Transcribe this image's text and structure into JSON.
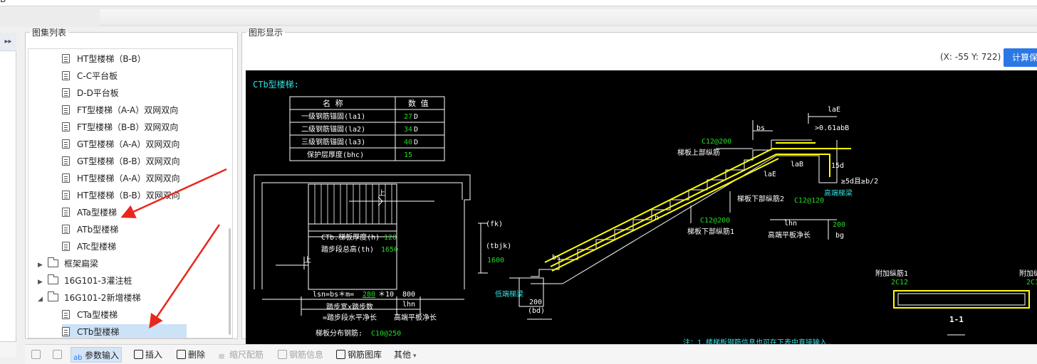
{
  "window": {
    "title_fragment": "B"
  },
  "list_panel": {
    "title": "图集列表",
    "items": [
      {
        "kind": "leaf",
        "label": "HT型楼梯（B-B）"
      },
      {
        "kind": "leaf",
        "label": "C-C平台板"
      },
      {
        "kind": "leaf",
        "label": "D-D平台板"
      },
      {
        "kind": "leaf",
        "label": "FT型楼梯（A-A）双网双向"
      },
      {
        "kind": "leaf",
        "label": "FT型楼梯（B-B）双网双向"
      },
      {
        "kind": "leaf",
        "label": "GT型楼梯（A-A）双网双向"
      },
      {
        "kind": "leaf",
        "label": "GT型楼梯（B-B）双网双向"
      },
      {
        "kind": "leaf",
        "label": "HT型楼梯（A-A）双网双向"
      },
      {
        "kind": "leaf",
        "label": "HT型楼梯（B-B）双网双向"
      },
      {
        "kind": "leaf",
        "label": "ATa型楼梯"
      },
      {
        "kind": "leaf",
        "label": "ATb型楼梯"
      },
      {
        "kind": "leaf",
        "label": "ATc型楼梯"
      },
      {
        "kind": "folder",
        "expanded": false,
        "label": "框架扁梁"
      },
      {
        "kind": "folder",
        "expanded": false,
        "label": "16G101-3灌注桩"
      },
      {
        "kind": "folder",
        "expanded": true,
        "label": "16G101-2新增楼梯"
      },
      {
        "kind": "leaf",
        "label": "CTa型楼梯"
      },
      {
        "kind": "leaf",
        "label": "CTb型楼梯",
        "selected": true
      }
    ]
  },
  "graph_panel": {
    "title": "图形显示",
    "coords": "(X: -55 Y: 722)",
    "calc_button": "计算保"
  },
  "drawing": {
    "title": "CTb型楼梯:",
    "table": {
      "headers": [
        "名  称",
        "数  值"
      ],
      "rows": [
        {
          "name": "一级钢筋锚固(la1)",
          "value": "27",
          "unit": "D"
        },
        {
          "name": "二级钢筋锚固(la2)",
          "value": "34",
          "unit": "D"
        },
        {
          "name": "三级钢筋锚固(la3)",
          "value": "40",
          "unit": "D"
        },
        {
          "name": "保护层厚度(bhc)",
          "value": "15",
          "unit": ""
        }
      ]
    },
    "plan": {
      "thickness_label": "CTb.梯板厚度(h)",
      "thickness_value": "120",
      "height_label": "踏步段总高(th)",
      "height_value": "1650",
      "fk": "(fk)",
      "tbjk": "(tbjk)",
      "v1600": "1600",
      "lsn_prefix": "lsn=bs＊m=",
      "lsn_a": "280",
      "lsn_b": "10",
      "v800": "800",
      "lhn_small": "lhn",
      "tread_note1": "踏步宽x踏步数",
      "tread_note2": "=踏步段水平净长",
      "high_end": "高端平板净长",
      "dist_label": "梯板分布钢筋:",
      "dist_value": "C10@250",
      "up_mark": "上"
    },
    "section": {
      "bs_top": "bs",
      "bs_bottom": "bs",
      "la_e": "laE",
      "la_e_note": ">0.61abB",
      "top_rebar_spec": "C12@200",
      "top_rebar_label": "梯板上部纵筋",
      "lab": "laB",
      "lae2": "laE",
      "v15d": "15d",
      "v5d": "≥5d且≥b/2",
      "high_beam": "高端梯梁",
      "bottom2_label": "梯板下部纵筋2",
      "bottom2_spec": "C12@120",
      "bottom1_spec": "C12@200",
      "bottom1_label": "梯板下部纵筋1",
      "lhn": "lhn",
      "v200_right": "200",
      "bg": "bg",
      "high_slab": "高端平板净长",
      "low_beam": "低端梯梁",
      "v200_low": "200",
      "bd": "(bd)",
      "h_mark": "h"
    },
    "detail": {
      "add1_label": "附加纵筋1",
      "add1_spec": "2C12",
      "add2_label": "附加纵",
      "add2_spec": "2C1",
      "cut_label": "1-1"
    },
    "note": "注：1.楼梯板钢筋信息也可在下表中直接输入."
  },
  "toolbar": {
    "param_input": "参数输入",
    "insert": "插入",
    "delete": "删除",
    "scale_rebar": "缩尺配筋",
    "rebar_info": "钢筋信息",
    "rebar_library": "钢筋图库",
    "other": "其他"
  },
  "colors": {
    "canvas_bg": "#000000",
    "drawing_white": "#ffffff",
    "drawing_green": "#22dd22",
    "drawing_cyan": "#33e0e0",
    "rebar_yellow": "#ffff00",
    "accent_blue": "#2b78e4",
    "annotation_red": "#e8281e",
    "selection_bg": "#cce2f7"
  }
}
